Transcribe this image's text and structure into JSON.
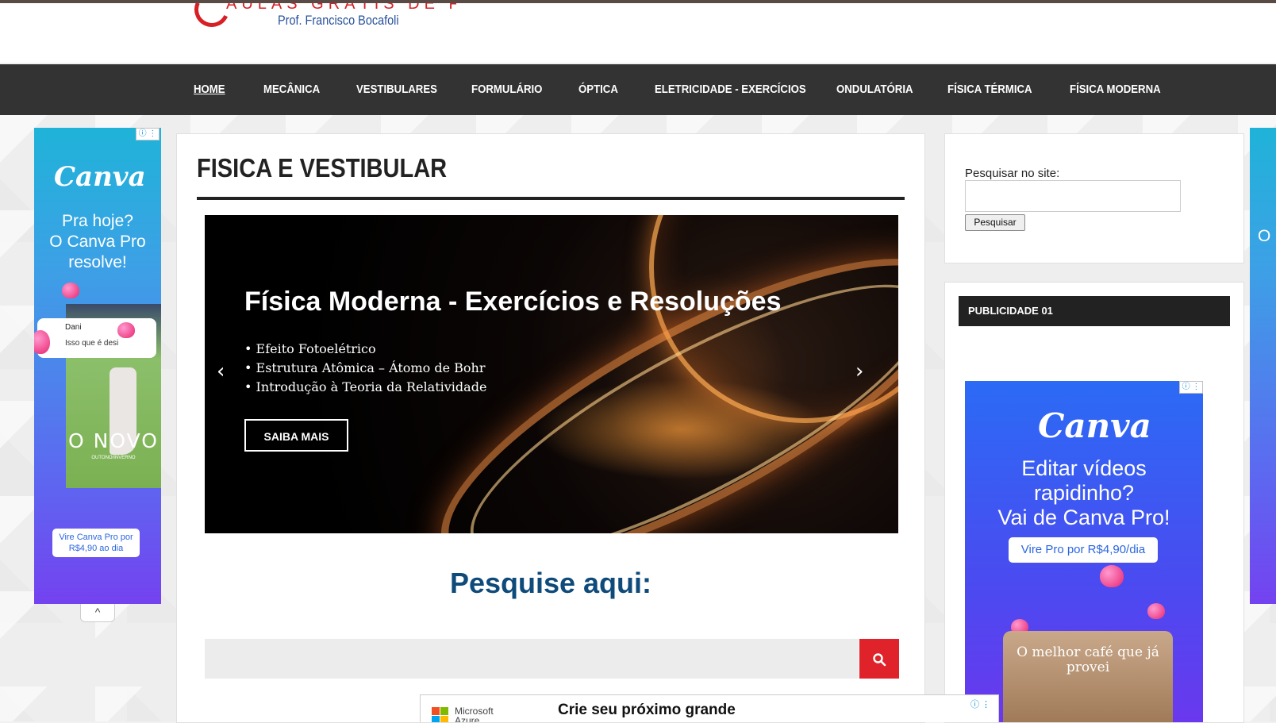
{
  "logo": {
    "title": "AULAS GRÁTIS DE FÍSICA",
    "subtitle": "Prof. Francisco Bocafoli"
  },
  "nav": {
    "items": [
      {
        "label": "HOME"
      },
      {
        "label": "MECÂNICA"
      },
      {
        "label": "VESTIBULARES"
      },
      {
        "label": "FORMULÁRIO"
      },
      {
        "label": "ÓPTICA"
      },
      {
        "label": "ELETRICIDADE - EXERCÍCIOS"
      },
      {
        "label": "ONDULATÓRIA"
      },
      {
        "label": "FÍSICA TÉRMICA"
      },
      {
        "label": "FÍSICA MODERNA"
      }
    ]
  },
  "main": {
    "title": "FISICA E VESTIBULAR",
    "slide": {
      "heading": "Física Moderna - Exercícios e Resoluções",
      "bullets": [
        "• Efeito Fotoelétrico",
        "• Estrutura Atômica – Átomo de Bohr",
        "• Introdução à Teoria da Relatividade"
      ],
      "button": "SAIBA MAIS",
      "prev_icon": "‹",
      "next_icon": "›"
    },
    "search_heading": "Pesquise aqui:",
    "search_icon": "search-icon"
  },
  "sidebar": {
    "search_label": "Pesquisar no site:",
    "search_button": "Pesquisar",
    "widget_title": "PUBLICIDADE 01"
  },
  "ad_left": {
    "brand": "Canva",
    "text": "Pra hoje?\nO Canva Pro\nresolve!",
    "chat_name": "Dani",
    "chat_msg": "Isso que é desi",
    "product": "O NOVO",
    "product_sub": "OUTONO/INVERNO",
    "cta": "Vire Canva Pro por R$4,90 ao dia",
    "collapse": "^"
  },
  "ad_right": {
    "brand": "Canva",
    "text": "Editar vídeos\nrapidinho?\nVai de Canva Pro!",
    "cta": "Vire Pro por R$4,90/dia",
    "promo": "O melhor café que já provei"
  },
  "ad_edge": {
    "text": "O"
  },
  "bottom_ad": {
    "brand": "Microsoft Azure",
    "headline": "Crie seu próximo grande"
  },
  "ad_badge": "ⓘ ⋮",
  "colors": {
    "nav_bg": "#333333",
    "accent_red": "#e0222a",
    "heading_blue": "#0e4a7a"
  }
}
